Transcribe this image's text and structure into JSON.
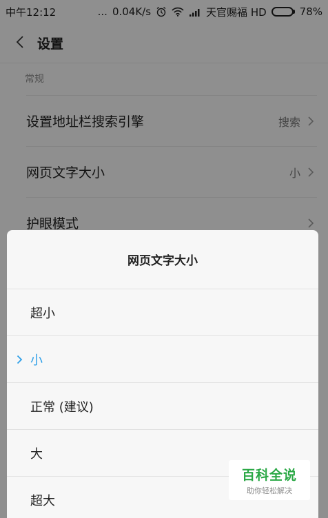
{
  "status_bar": {
    "time": "中午12:12",
    "dots": "...",
    "network_speed": "0.04K/s",
    "carrier": "天官赐福 HD",
    "battery_text": "78%",
    "battery_level": 0.78
  },
  "header": {
    "title": "设置"
  },
  "section": {
    "label": "常规"
  },
  "settings": [
    {
      "label": "设置地址栏搜索引擎",
      "value": "搜索"
    },
    {
      "label": "网页文字大小",
      "value": "小"
    },
    {
      "label": "护眼模式",
      "value": ""
    }
  ],
  "dialog": {
    "title": "网页文字大小",
    "options": [
      {
        "label": "超小"
      },
      {
        "label": "小"
      },
      {
        "label": "正常 (建议)"
      },
      {
        "label": "大"
      },
      {
        "label": "超大"
      }
    ],
    "selected_index": 1
  },
  "watermark": {
    "main": "百科全说",
    "sub": "助你轻松解决"
  },
  "colors": {
    "accent": "#2d9fe8",
    "watermark_green": "#2aa845"
  }
}
